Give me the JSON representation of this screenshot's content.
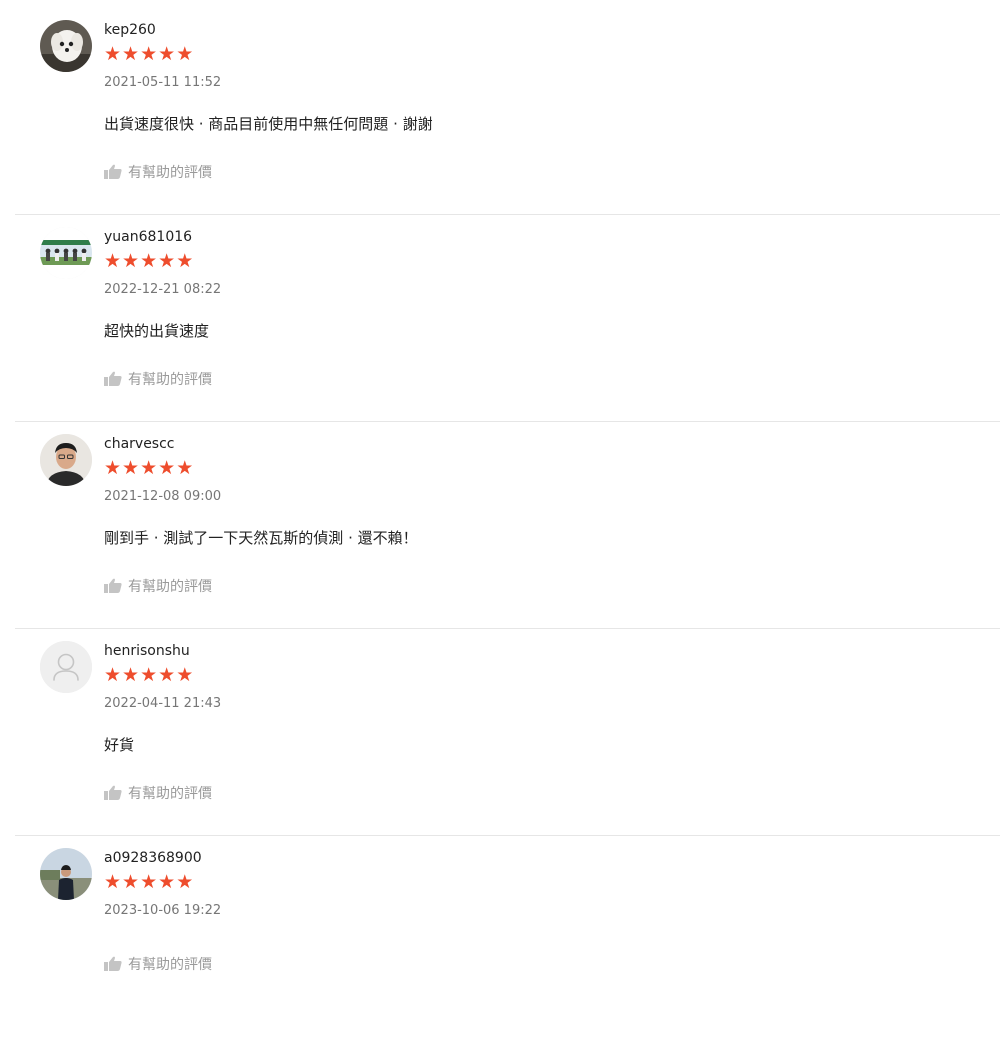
{
  "colors": {
    "star": "#ee4d2d",
    "meta_text": "#767676",
    "helpful_text": "#9a9a9a",
    "divider": "#e6e6e6"
  },
  "star_glyph": "★",
  "reviews": [
    {
      "username": "kep260",
      "rating": 5,
      "timestamp": "2021-05-11 11:52",
      "comment": "出貨速度很快 · 商品目前使用中無任何問題 · 謝謝",
      "helpful_label": "有幫助的評價",
      "avatar_icon": "dog-photo-avatar"
    },
    {
      "username": "yuan681016",
      "rating": 5,
      "timestamp": "2022-12-21 08:22",
      "comment": "超快的出貨速度",
      "helpful_label": "有幫助的評價",
      "avatar_icon": "group-photo-avatar"
    },
    {
      "username": "charvescc",
      "rating": 5,
      "timestamp": "2021-12-08 09:00",
      "comment": "剛到手 · 測試了一下天然瓦斯的偵測 · 還不賴！",
      "helpful_label": "有幫助的評價",
      "avatar_icon": "person-photo-avatar"
    },
    {
      "username": "henrisonshu",
      "rating": 5,
      "timestamp": "2022-04-11 21:43",
      "comment": "好貨",
      "helpful_label": "有幫助的評價",
      "avatar_icon": "default-user-avatar"
    },
    {
      "username": "a0928368900",
      "rating": 5,
      "timestamp": "2023-10-06 19:22",
      "comment": "",
      "helpful_label": "有幫助的評價",
      "avatar_icon": "person-outdoor-photo-avatar"
    }
  ]
}
